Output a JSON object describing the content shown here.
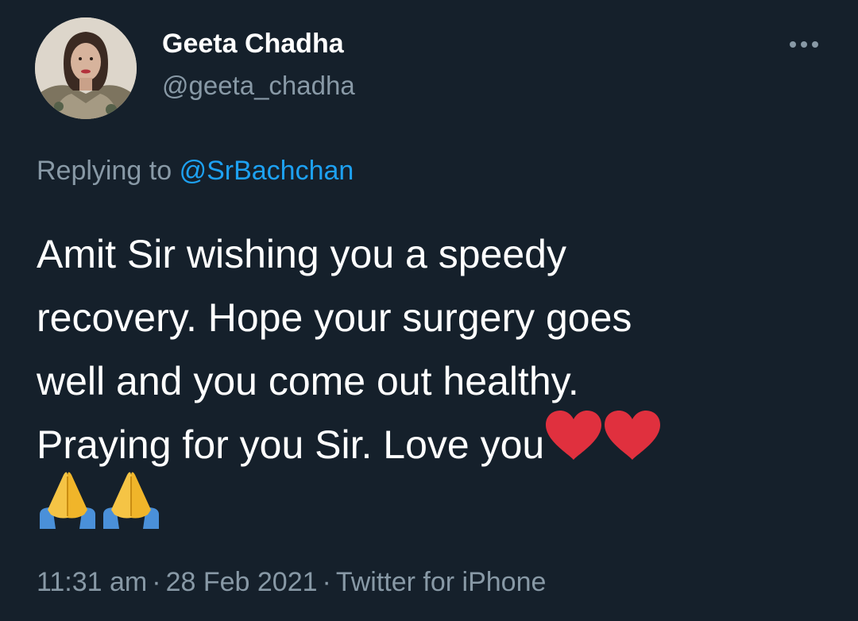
{
  "user": {
    "display_name": "Geeta Chadha",
    "handle": "@geeta_chadha"
  },
  "reply": {
    "prefix": "Replying to",
    "mention": "@SrBachchan"
  },
  "tweet": {
    "lines": [
      "Amit Sir wishing you a speedy",
      "recovery. Hope your surgery goes",
      "well and you come out healthy.",
      "Praying for you Sir. Love you"
    ]
  },
  "meta": {
    "time": "11:31 am",
    "separator": "·",
    "date": "28 Feb 2021",
    "source": "Twitter for iPhone"
  },
  "icons": {
    "more": "more-horizontal-icon",
    "heart": "red-heart-emoji",
    "pray": "folded-hands-emoji"
  },
  "colors": {
    "background": "#15202b",
    "text": "#ffffff",
    "muted": "#8899a6",
    "link": "#1da1f2",
    "heart": "#e0303e"
  }
}
